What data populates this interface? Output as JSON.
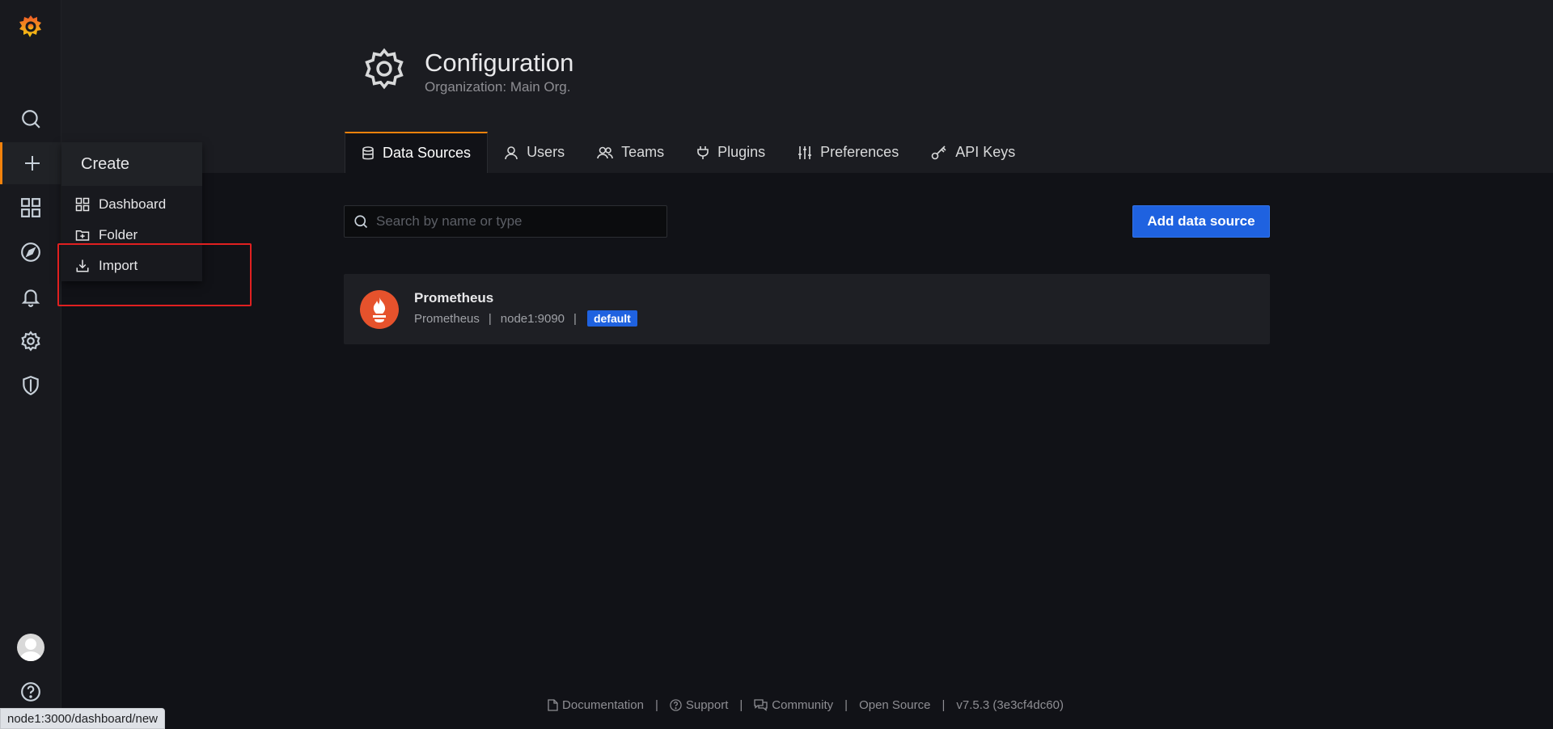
{
  "header": {
    "title": "Configuration",
    "subtitle": "Organization: Main Org."
  },
  "tabs": [
    {
      "label": "Data Sources",
      "active": true
    },
    {
      "label": "Users"
    },
    {
      "label": "Teams"
    },
    {
      "label": "Plugins"
    },
    {
      "label": "Preferences"
    },
    {
      "label": "API Keys"
    }
  ],
  "flyout": {
    "title": "Create",
    "items": [
      {
        "label": "Dashboard"
      },
      {
        "label": "Folder"
      },
      {
        "label": "Import"
      }
    ]
  },
  "search": {
    "placeholder": "Search by name or type",
    "value": ""
  },
  "add_button": "Add data source",
  "datasource": {
    "name": "Prometheus",
    "type": "Prometheus",
    "url": "node1:9090",
    "badge": "default"
  },
  "footer": {
    "documentation": "Documentation",
    "support": "Support",
    "community": "Community",
    "open_source": "Open Source",
    "version": "v7.5.3 (3e3cf4dc60)",
    "separator": "|"
  },
  "status_bar": "node1:3000/dashboard/new",
  "colors": {
    "accent": "#f2820c",
    "primary_button": "#1f62e0",
    "highlight": "#e02020",
    "prometheus": "#e6522c"
  }
}
